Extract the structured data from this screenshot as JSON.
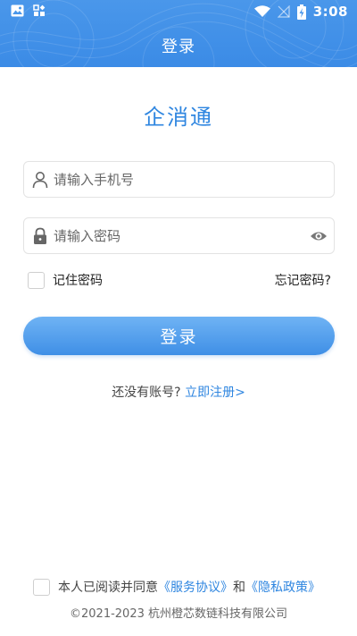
{
  "status_bar": {
    "time": "3:08"
  },
  "header": {
    "title": "登录",
    "color": "#3b8be6"
  },
  "app": {
    "name": "企消通"
  },
  "phone_field": {
    "placeholder": "请输入手机号",
    "value": ""
  },
  "password_field": {
    "placeholder": "请输入密码",
    "value": ""
  },
  "remember": {
    "label": "记住密码",
    "checked": false
  },
  "forgot": {
    "label": "忘记密码?"
  },
  "login_button": {
    "label": "登录"
  },
  "register": {
    "prefix": "还没有账号?",
    "link": "立即注册>"
  },
  "agreement": {
    "checked": false,
    "prefix": "本人已阅读并同意",
    "service_link": "《服务协议》",
    "conjunction": "和",
    "privacy_link": "《隐私政策》"
  },
  "footer": {
    "copyright": "©2021-2023 杭州橙芯数链科技有限公司"
  },
  "colors": {
    "accent": "#2f86e0",
    "button_top": "#6fb3f4",
    "button_bottom": "#3f8fe6"
  }
}
